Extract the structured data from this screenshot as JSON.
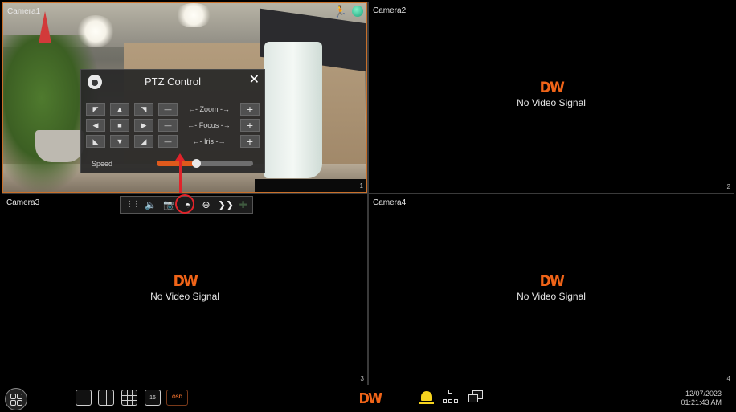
{
  "tiles": [
    {
      "name": "Camera1",
      "number": "1"
    },
    {
      "name": "Camera2",
      "number": "2",
      "status": "No Video Signal",
      "logo": "DW"
    },
    {
      "name": "Camera3",
      "number": "3",
      "status": "No Video Signal",
      "logo": "DW"
    },
    {
      "name": "Camera4",
      "number": "4",
      "status": "No Video Signal",
      "logo": "DW"
    }
  ],
  "camera1_alarm_icons": [
    "motion-run-icon",
    "record-disk-icon"
  ],
  "ptz": {
    "title": "PTZ Control",
    "close": "✕",
    "rows": [
      {
        "label": "Zoom",
        "minus": "—",
        "plus": "+"
      },
      {
        "label": "Focus",
        "minus": "—",
        "plus": "+"
      },
      {
        "label": "Iris",
        "minus": "—",
        "plus": "+"
      }
    ],
    "speed_label": "Speed",
    "speed_value": 0.42
  },
  "camera_toolbar": {
    "icons": [
      "drag-grip-icon",
      "mute-audio-icon",
      "snapshot-camera-icon",
      "ptz-dome-icon",
      "zoom-in-icon",
      "fish-eye-icon",
      "more-icon"
    ]
  },
  "taskbar": {
    "osd_label": "OSD",
    "layout_16_label": "16",
    "logo": "DW",
    "date": "12/07/2023",
    "time": "01:21:43 AM"
  },
  "colors": {
    "accent": "#f06418",
    "selected_border": "#c9702a",
    "annotation": "#e0232a",
    "alarm_bell": "#f6d31e"
  }
}
